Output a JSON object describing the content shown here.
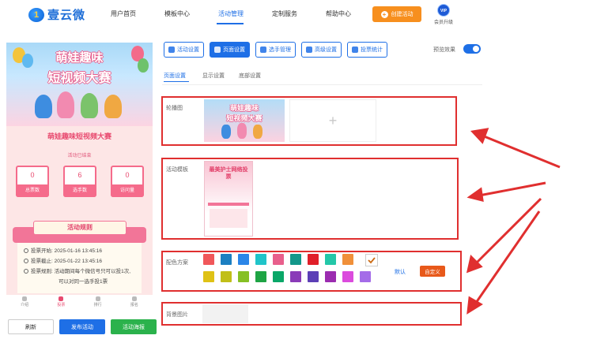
{
  "logo": {
    "text": "壹云微",
    "mark": "1"
  },
  "nav": {
    "items": [
      "用户首页",
      "模板中心",
      "活动管理",
      "定制服务",
      "帮助中心"
    ],
    "create_button": "创建活动",
    "vip_badge": "VIP",
    "vip_label": "会员升级"
  },
  "preview": {
    "banner_line1": "萌娃趣味",
    "banner_line2": "短视频大赛",
    "activity_title": "萌娃趣味短视频大赛",
    "status": "活动已结束",
    "stats": [
      {
        "value": "0",
        "label": "总票数"
      },
      {
        "value": "6",
        "label": "选手数"
      },
      {
        "value": "0",
        "label": "访问量"
      }
    ],
    "rules_title": "活动规则",
    "rules": [
      {
        "key": "投票开始:",
        "value": "2025-01-16 13:45:16"
      },
      {
        "key": "投票截止:",
        "value": "2025-01-22 13:45:16"
      },
      {
        "key": "投票规则:",
        "value": "活动期间每个微信号只可以投1次,"
      },
      {
        "key": "",
        "value": "可以对同一选手投1票"
      }
    ],
    "tabbar": [
      "介绍",
      "投票",
      "排行",
      "报名"
    ],
    "buttons": {
      "refresh": "刷新",
      "publish": "发布活动",
      "poster": "活动海报"
    }
  },
  "toolbar": {
    "buttons": [
      "活动设置",
      "页面设置",
      "选手管理",
      "高级设置",
      "投票统计"
    ],
    "active": "页面设置",
    "preview_label": "预览效果"
  },
  "subtabs": [
    "页面设置",
    "显示设置",
    "底部设置"
  ],
  "sections": {
    "carousel_label": "轮播图",
    "template_label": "活动模板",
    "template_thumb_text": "最美护士网络投票",
    "color_label": "配色方案",
    "default_link": "默认",
    "custom_button": "自定义",
    "background_label": "背景图片",
    "upload_plus": "+"
  },
  "colors": {
    "row1": [
      "#f0575a",
      "#1c7fc1",
      "#2b86e8",
      "#20c4c9",
      "#e85f8c",
      "#13978a",
      "#e01f29",
      "#23c7a8",
      "#f0903a",
      "#cc6b14"
    ],
    "row2": [
      "#dfc215",
      "#c1bf18",
      "#86c024",
      "#1ea444",
      "#0aa768",
      "#8a3bb8",
      "#5c3fb6",
      "#9b2cb0",
      "#db4bdd",
      "#a46ce8"
    ],
    "accent": "#1e6fe6",
    "annotation": "#e02f2f"
  }
}
